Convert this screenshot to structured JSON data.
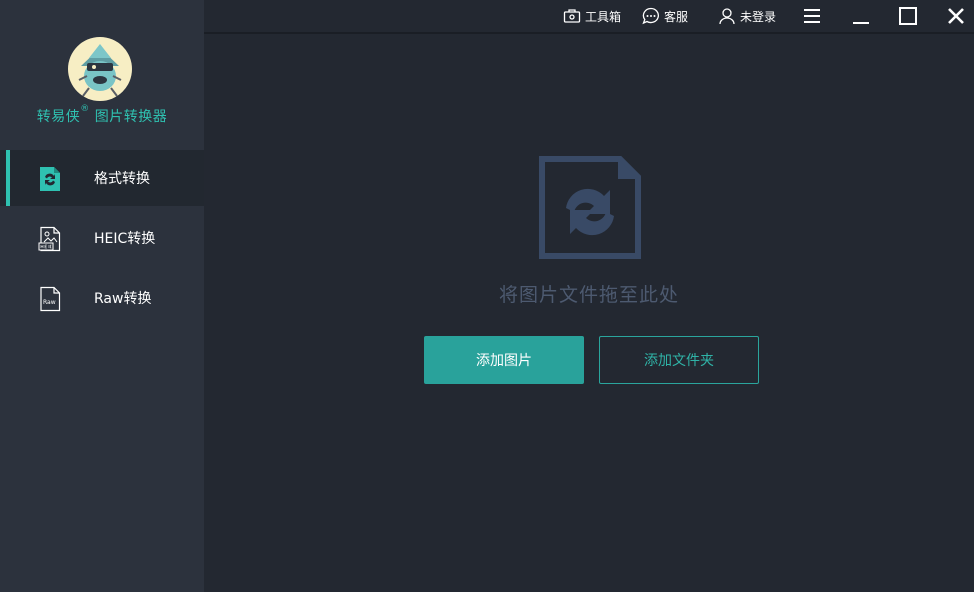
{
  "app": {
    "brand_name": "转易侠",
    "brand_mark": "®",
    "brand_suffix": "图片转换器"
  },
  "sidebar": {
    "items": [
      {
        "label": "格式转换",
        "icon": "format-convert-icon",
        "active": true
      },
      {
        "label": "HEIC转换",
        "icon": "heic-image-icon",
        "active": false
      },
      {
        "label": "Raw转换",
        "icon": "raw-file-icon",
        "active": false
      }
    ]
  },
  "topbar": {
    "toolbox": "工具箱",
    "support": "客服",
    "login": "未登录"
  },
  "main": {
    "drop_hint": "将图片文件拖至此处",
    "add_images": "添加图片",
    "add_folder": "添加文件夹"
  },
  "colors": {
    "accent": "#2fc1b1",
    "sidebar_bg": "#2c323d",
    "main_bg": "#232831"
  }
}
